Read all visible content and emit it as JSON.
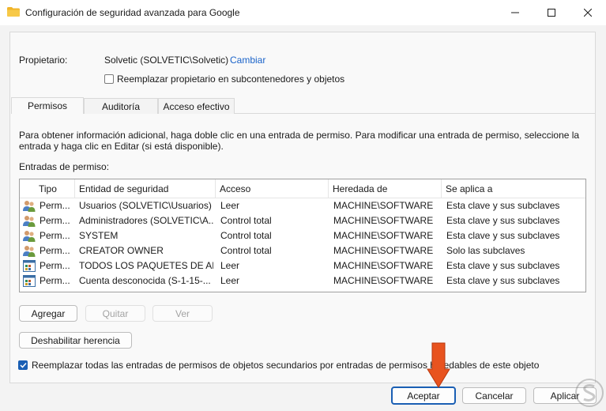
{
  "window": {
    "title": "Configuración de seguridad avanzada para Google",
    "icon": "folder-icon"
  },
  "owner": {
    "label": "Propietario:",
    "value": "Solvetic (SOLVETIC\\Solvetic)",
    "change_link": "Cambiar",
    "replace_checkbox_label": "Reemplazar propietario en subcontenedores y objetos",
    "replace_checked": false
  },
  "tabs": [
    {
      "label": "Permisos",
      "active": true
    },
    {
      "label": "Auditoría",
      "active": false
    },
    {
      "label": "Acceso efectivo",
      "active": false
    }
  ],
  "permissions": {
    "info_line1": "Para obtener información adicional, haga doble clic en una entrada de permiso. Para modificar una entrada de permiso, seleccione la",
    "info_line2": "entrada y haga clic en Editar (si está disponible).",
    "entries_label": "Entradas de permiso:",
    "columns": [
      "Tipo",
      "Entidad de seguridad",
      "Acceso",
      "Heredada de",
      "Se aplica a"
    ],
    "rows": [
      {
        "icon": "users-icon",
        "type": "Perm...",
        "principal": "Usuarios (SOLVETIC\\Usuarios)",
        "access": "Leer",
        "inherited": "MACHINE\\SOFTWARE",
        "applies": "Esta clave y sus subclaves"
      },
      {
        "icon": "users-icon",
        "type": "Perm...",
        "principal": "Administradores (SOLVETIC\\A...",
        "access": "Control total",
        "inherited": "MACHINE\\SOFTWARE",
        "applies": "Esta clave y sus subclaves"
      },
      {
        "icon": "users-icon",
        "type": "Perm...",
        "principal": "SYSTEM",
        "access": "Control total",
        "inherited": "MACHINE\\SOFTWARE",
        "applies": "Esta clave y sus subclaves"
      },
      {
        "icon": "users-icon",
        "type": "Perm...",
        "principal": "CREATOR OWNER",
        "access": "Control total",
        "inherited": "MACHINE\\SOFTWARE",
        "applies": "Solo las subclaves"
      },
      {
        "icon": "app-package-icon",
        "type": "Perm...",
        "principal": "TODOS LOS PAQUETES DE AP...",
        "access": "Leer",
        "inherited": "MACHINE\\SOFTWARE",
        "applies": "Esta clave y sus subclaves"
      },
      {
        "icon": "app-package-icon",
        "type": "Perm...",
        "principal": "Cuenta desconocida (S-1-15-...",
        "access": "Leer",
        "inherited": "MACHINE\\SOFTWARE",
        "applies": "Esta clave y sus subclaves"
      }
    ],
    "buttons": {
      "add": "Agregar",
      "remove": "Quitar",
      "view": "Ver"
    },
    "disable_inheritance": "Deshabilitar herencia",
    "replace_all_label": "Reemplazar todas las entradas de permisos de objetos secundarios por entradas de permisos heredables de este objeto",
    "replace_all_checked": true
  },
  "footer": {
    "ok": "Aceptar",
    "cancel": "Cancelar",
    "apply": "Aplicar"
  },
  "colors": {
    "accent": "#1a5fb4",
    "link": "#1a63c9",
    "arrow": "#e8531f"
  }
}
